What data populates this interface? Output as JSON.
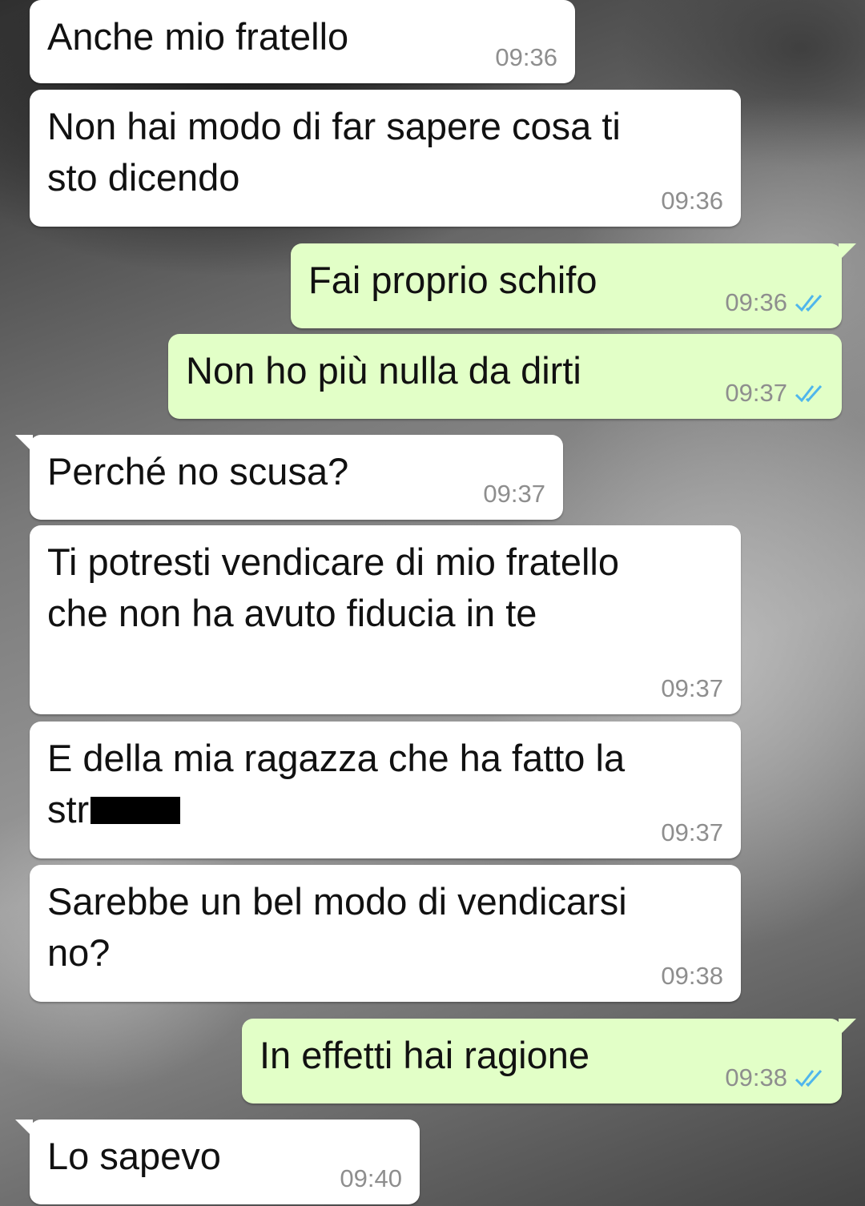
{
  "conversation": {
    "messages": [
      {
        "id": "m1",
        "direction": "in",
        "text": "Anche mio fratello",
        "time": "09:36"
      },
      {
        "id": "m2",
        "direction": "in",
        "text": "Non hai modo di far sapere cosa ti\nsto dicendo",
        "time": "09:36"
      },
      {
        "id": "m3",
        "direction": "out",
        "text": "Fai proprio schifo",
        "time": "09:36",
        "status": "read"
      },
      {
        "id": "m4",
        "direction": "out",
        "text": "Non ho più nulla da dirti",
        "time": "09:37",
        "status": "read"
      },
      {
        "id": "m5",
        "direction": "in",
        "text": "Perché no scusa?",
        "time": "09:37"
      },
      {
        "id": "m6",
        "direction": "in",
        "text": "Ti potresti vendicare di mio fratello\nche non ha avuto fiducia in te",
        "time": "09:37"
      },
      {
        "id": "m7",
        "direction": "in",
        "text_line1": "E della mia ragazza che ha fatto la",
        "text_line2_visible": "str",
        "time": "09:37",
        "redacted": true
      },
      {
        "id": "m8",
        "direction": "in",
        "text": "Sarebbe un bel modo di vendicarsi\nno?",
        "time": "09:38"
      },
      {
        "id": "m9",
        "direction": "out",
        "text": "In effetti hai ragione",
        "time": "09:38",
        "status": "read"
      },
      {
        "id": "m10",
        "direction": "in",
        "text": "Lo sapevo",
        "time": "09:40"
      }
    ]
  },
  "colors": {
    "incoming_bubble": "#ffffff",
    "outgoing_bubble": "#e2ffc7",
    "timestamp": "#8e8e8e",
    "read_ticks": "#4fb6ec",
    "redaction": "#000000"
  },
  "icons": {
    "read_status": "double-check-icon"
  }
}
